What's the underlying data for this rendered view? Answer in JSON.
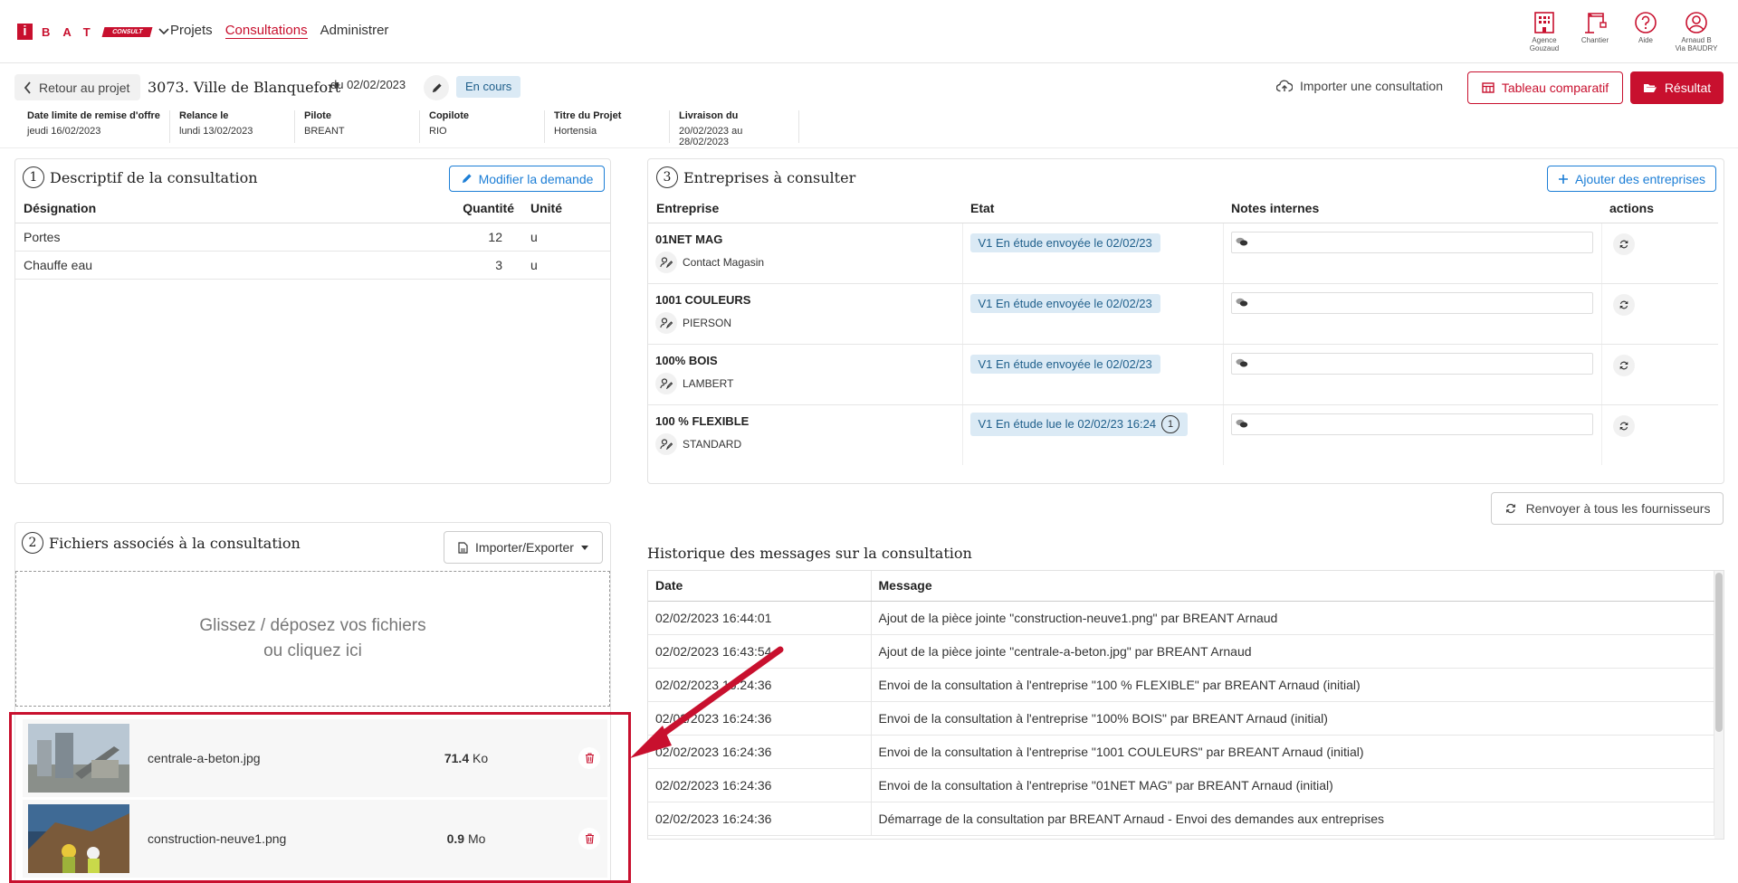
{
  "nav": {
    "logo_letters": "BAT",
    "logo_consult": "CONSULT",
    "links": [
      "Projets",
      "Consultations",
      "Administrer"
    ],
    "active": "Consultations",
    "icons": [
      {
        "name": "building-icon",
        "label1": "Agence",
        "label2": "Gouzaud"
      },
      {
        "name": "crane-icon",
        "label1": "Chantier",
        "label2": ""
      },
      {
        "name": "help-icon",
        "label1": "Aide",
        "label2": ""
      },
      {
        "name": "user-icon",
        "label1": "Arnaud B",
        "label2": "Via BAUDRY"
      }
    ]
  },
  "header": {
    "back_label": "Retour au projet",
    "title": "3073. Ville de Blanquefort",
    "date": "du 02/02/2023",
    "status": "En cours",
    "import_label": "Importer une consultation",
    "compare_label": "Tableau comparatif",
    "result_label": "Résultat",
    "meta": [
      {
        "key": "Date limite de remise d'offre",
        "value": "jeudi 16/02/2023"
      },
      {
        "key": "Relance le",
        "value": "lundi 13/02/2023"
      },
      {
        "key": "Pilote",
        "value": "BREANT"
      },
      {
        "key": "Copilote",
        "value": "RIO"
      },
      {
        "key": "Titre du Projet",
        "value": "Hortensia"
      },
      {
        "key": "Livraison du",
        "value": "20/02/2023 au 28/02/2023"
      }
    ]
  },
  "descriptif": {
    "num": "1",
    "title": "Descriptif de la consultation",
    "button": "Modifier la demande",
    "columns": [
      "Désignation",
      "Quantité",
      "Unité"
    ],
    "rows": [
      {
        "designation": "Portes",
        "quantite": "12",
        "unite": "u"
      },
      {
        "designation": "Chauffe eau",
        "quantite": "3",
        "unite": "u"
      }
    ]
  },
  "entreprises": {
    "num": "3",
    "title": "Entreprises à consulter",
    "button": "Ajouter des entreprises",
    "columns": [
      "Entreprise",
      "Etat",
      "Notes internes",
      "actions"
    ],
    "rows": [
      {
        "name": "01NET MAG",
        "contact": "Contact Magasin",
        "etat": "V1 En étude envoyée le 02/02/23",
        "count": ""
      },
      {
        "name": "1001 COULEURS",
        "contact": "PIERSON",
        "etat": "V1 En étude envoyée le 02/02/23",
        "count": ""
      },
      {
        "name": "100% BOIS",
        "contact": "LAMBERT",
        "etat": "V1 En étude envoyée le 02/02/23",
        "count": ""
      },
      {
        "name": "100 % FLEXIBLE",
        "contact": "STANDARD",
        "etat": "V1 En étude lue le 02/02/23 16:24",
        "count": "1"
      }
    ],
    "resend_label": "Renvoyer à tous les fournisseurs"
  },
  "fichiers": {
    "num": "2",
    "title": "Fichiers associés à la consultation",
    "button": "Importer/Exporter",
    "drop_line1": "Glissez / déposez vos fichiers",
    "drop_line2": "ou cliquez ici",
    "files": [
      {
        "name": "centrale-a-beton.jpg",
        "size": "71.4",
        "unit": "Ko"
      },
      {
        "name": "construction-neuve1.png",
        "size": "0.9",
        "unit": "Mo"
      }
    ]
  },
  "historique": {
    "title": "Historique des messages sur la consultation",
    "columns": [
      "Date",
      "Message"
    ],
    "rows": [
      {
        "date": "02/02/2023 16:44:01",
        "message": "Ajout de la pièce jointe \"construction-neuve1.png\" par BREANT Arnaud"
      },
      {
        "date": "02/02/2023 16:43:54",
        "message": "Ajout de la pièce jointe \"centrale-a-beton.jpg\" par BREANT Arnaud"
      },
      {
        "date": "02/02/2023 16:24:36",
        "message": "Envoi de la consultation à l'entreprise \"100 % FLEXIBLE\" par BREANT Arnaud (initial)"
      },
      {
        "date": "02/02/2023 16:24:36",
        "message": "Envoi de la consultation à l'entreprise \"100% BOIS\" par BREANT Arnaud (initial)"
      },
      {
        "date": "02/02/2023 16:24:36",
        "message": "Envoi de la consultation à l'entreprise \"1001 COULEURS\" par BREANT Arnaud (initial)"
      },
      {
        "date": "02/02/2023 16:24:36",
        "message": "Envoi de la consultation à l'entreprise \"01NET MAG\" par BREANT Arnaud (initial)"
      },
      {
        "date": "02/02/2023 16:24:36",
        "message": "Démarrage de la consultation par BREANT Arnaud - Envoi des demandes aux entreprises"
      }
    ]
  },
  "colors": {
    "brand": "#c8102e",
    "accent": "#1c7ed6",
    "badge_bg": "#dbeaf5"
  }
}
